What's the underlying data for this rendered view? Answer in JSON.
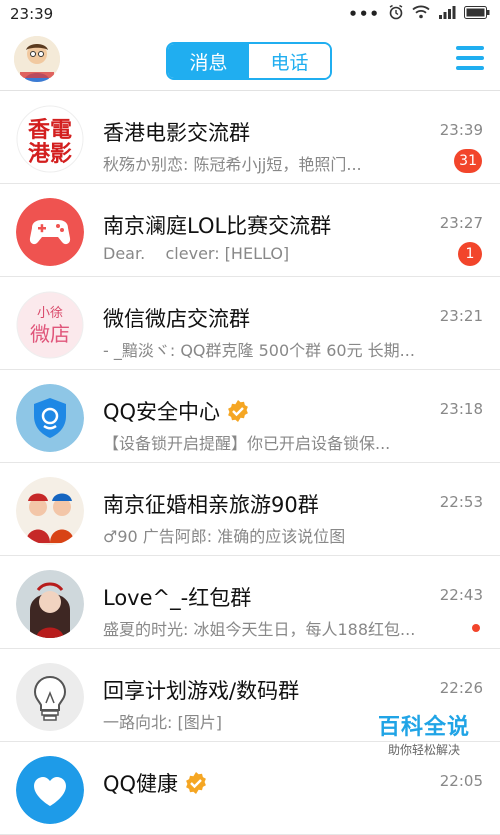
{
  "status_bar": {
    "time": "23:39",
    "dots": "•••"
  },
  "header": {
    "tabs": [
      {
        "label": "消息",
        "active": true
      },
      {
        "label": "电话",
        "active": false
      }
    ]
  },
  "colors": {
    "accent": "#20aef0",
    "badge": "#f2452b"
  },
  "conversations": [
    {
      "name": "香港电影交流群",
      "message": "秋殇か别恋: 陈冠希小jj短，艳照门...",
      "time": "23:39",
      "badge": "31",
      "avatar_text": "香電港影",
      "avatar": "hongkong-movie-avatar"
    },
    {
      "name": "南京澜庭LOL比赛交流群",
      "message": "Dear.    clever: [HELLO]",
      "time": "23:27",
      "badge": "1",
      "avatar": "gamepad-avatar"
    },
    {
      "name": "微信微店交流群",
      "message": "- _黯淡ヾ: QQ群克隆   500个群 60元 长期...",
      "time": "23:21",
      "avatar_text": "小徐 微店",
      "avatar": "weidian-avatar"
    },
    {
      "name": "QQ安全中心",
      "message": "【设备锁开启提醒】你已开启设备锁保...",
      "time": "23:18",
      "verified": true,
      "avatar": "shield-avatar"
    },
    {
      "name": "南京征婚相亲旅游90群",
      "message": "♂90 广告阿郎: 准确的应该说位图",
      "time": "22:53",
      "avatar": "opera-avatar"
    },
    {
      "name": "Love^_-红包群",
      "message": "盛夏的时光: 冰姐今天生日，每人188红包...",
      "time": "22:43",
      "badge": "",
      "avatar": "girl-avatar"
    },
    {
      "name": "回享计划游戏/数码群",
      "message": "一路向北: [图片]",
      "time": "22:26",
      "avatar": "lightbulb-avatar"
    },
    {
      "name": "QQ健康",
      "message": "",
      "time": "22:05",
      "verified": true,
      "avatar": "health-avatar"
    }
  ],
  "watermark": {
    "title": "百科全说",
    "subtitle": "助你轻松解决"
  }
}
